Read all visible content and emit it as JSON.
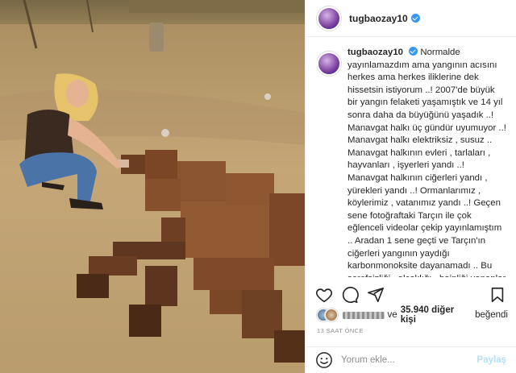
{
  "post": {
    "username": "tugbaozay10",
    "caption": "Normalde yayınlamazdım ama yangının acısını herkes ama herkes iliklerine dek hissetsin istiyorum ..! 2007'de büyük bir yangın felaketi yaşamıştık ve 14 yıl sonra daha da büyüğünü yaşadık ..! Manavgat halkı üç gündür uyumuyor ..! Manavgat halkı elektriksiz , susuz .. Manavgat halkının evleri , tarlaları , hayvanları , işyerleri yandı ..! Manavgat halkının ciğerleri yandı , yürekleri yandı ..! Ormanlarımız , köylerimiz , vatanımız yandı ..! Geçen sene fotoğraftaki Tarçın ile çok eğlenceli videolar çekip yayınlamıştım .. Aradan 1 sene geçti ve Tarçın'ın ciğerleri yangının yaydığı karbonmonoksite dayanamadı .. Bu şerefsizliği , alçaklığı , hainliği yapanlar , memlekete",
    "likes": {
      "prefix": "ve",
      "count": "35.940 diğer kişi",
      "suffix": "beğendi"
    },
    "time": "13 SAAT ÖNCE"
  },
  "comment_box": {
    "placeholder": "Yorum ekle...",
    "share_label": "Paylaş"
  },
  "icons": {
    "heart": "heart-icon",
    "comment": "comment-icon",
    "share": "paper-plane-icon",
    "save": "bookmark-icon",
    "emoji": "smiley-icon",
    "verified": "verified-badge-icon"
  },
  "colors": {
    "verified": "#3897f0",
    "share_disabled": "#b2dffc",
    "muted": "#8e8e8e"
  }
}
